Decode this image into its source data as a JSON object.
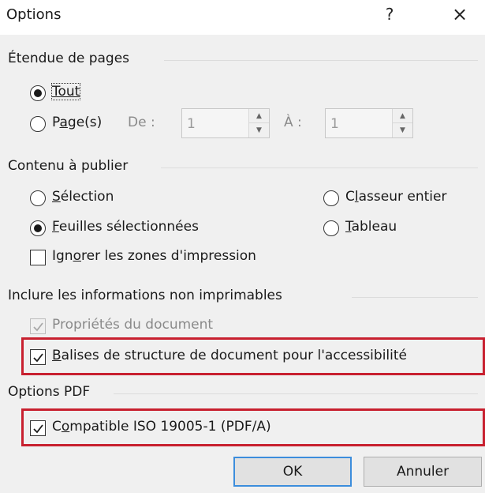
{
  "dialog": {
    "title": "Options",
    "help_glyph": "?",
    "close_glyph": "×"
  },
  "page_range": {
    "group_title": "Étendue de pages",
    "all": {
      "label": "Tout",
      "checked": true
    },
    "pages": {
      "label_u": "a",
      "label_pre": "P",
      "label_post": "ge(s)",
      "checked": false,
      "from_label": "De :",
      "from_value": "1",
      "to_label": "À :",
      "to_value": "1"
    }
  },
  "publish": {
    "group_title": "Contenu à publier",
    "selection": {
      "u": "S",
      "rest": "élection",
      "checked": false
    },
    "sheets": {
      "u": "F",
      "rest": "euilles sélectionnées",
      "checked": true
    },
    "workbook": {
      "pre": "C",
      "u": "l",
      "rest": "asseur entier",
      "checked": false
    },
    "table": {
      "u": "T",
      "rest": "ableau",
      "checked": false
    },
    "ignore": {
      "pre": "Ign",
      "u": "o",
      "rest": "rer les zones d'impression",
      "checked": false
    }
  },
  "nonprint": {
    "group_title": "Inclure les informations non imprimables",
    "doc_props": {
      "label": "Propriétés du document",
      "checked": true,
      "disabled": true
    },
    "struct_tags": {
      "u": "B",
      "rest": "alises de structure de document pour l'accessibilité",
      "checked": true
    }
  },
  "pdf": {
    "group_title": "Options PDF",
    "iso": {
      "pre": "C",
      "u": "o",
      "rest": "mpatible ISO 19005-1 (PDF/A)",
      "checked": true
    }
  },
  "buttons": {
    "ok": "OK",
    "cancel": "Annuler"
  },
  "colors": {
    "highlight": "#c8202f",
    "default_button_border": "#3c8ddc"
  }
}
